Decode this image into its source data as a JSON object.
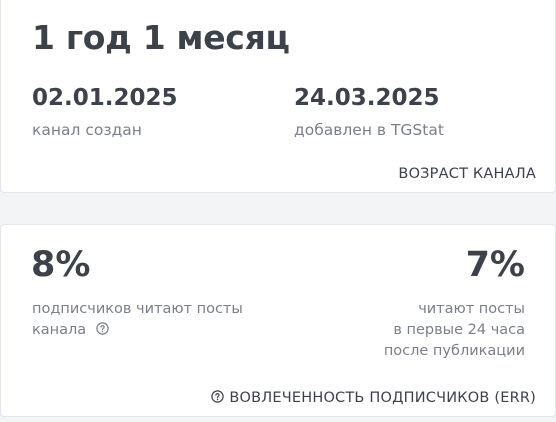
{
  "age_card": {
    "title": "1 год 1 месяц",
    "created_date": "02.01.2025",
    "created_label": "канал создан",
    "added_date": "24.03.2025",
    "added_label": "добавлен в TGStat",
    "footer_label": "ВОЗРАСТ КАНАЛА"
  },
  "err_card": {
    "left_percent": "8%",
    "left_desc_line1": "подписчиков читают посты",
    "left_desc_line2": "канала",
    "right_percent": "7%",
    "right_desc_line1": "читают посты",
    "right_desc_line2": "в первые 24 часа",
    "right_desc_line3": "после публикации",
    "footer_label": "ВОВЛЕЧЕННОСТЬ ПОДПИСЧИКОВ (ERR)"
  },
  "icons": {
    "help": "question-circle-icon"
  }
}
